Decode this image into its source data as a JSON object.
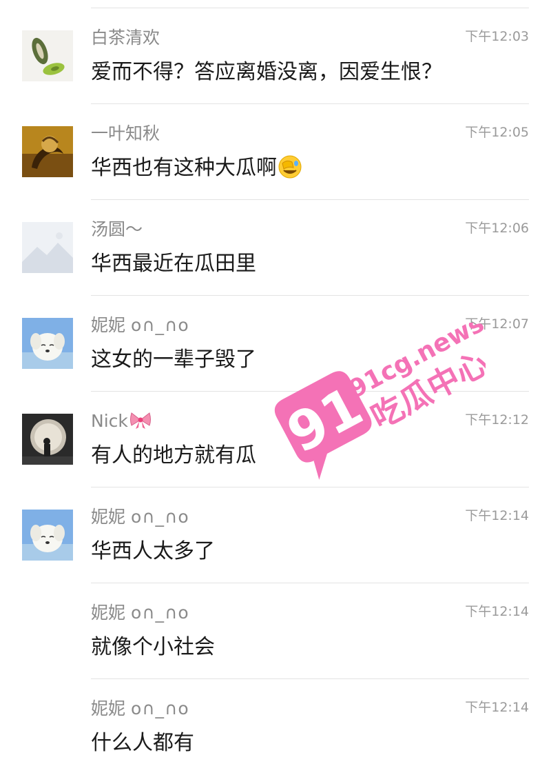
{
  "messages": [
    {
      "name": "白茶清欢",
      "name_suffix": "",
      "time": "下午12:03",
      "text": "爱而不得？答应离婚没离，因爱生恨？",
      "avatar": "leaf-avatar",
      "emoji": "",
      "name_icon": ""
    },
    {
      "name": "一叶知秋",
      "name_suffix": "",
      "time": "下午12:05",
      "text": "华西也有这种大瓜啊",
      "avatar": "autumn-avatar",
      "emoji": "facepalm-emoji",
      "name_icon": ""
    },
    {
      "name": "汤圆～",
      "name_suffix": "",
      "time": "下午12:06",
      "text": "华西最近在瓜田里",
      "avatar": "landscape-placeholder-avatar",
      "emoji": "",
      "name_icon": ""
    },
    {
      "name": "妮妮 ",
      "name_suffix": "o∩_∩o",
      "time": "下午12:07",
      "text": "这女的一辈子毁了",
      "avatar": "dog-avatar",
      "emoji": "",
      "name_icon": ""
    },
    {
      "name": "Nick",
      "name_suffix": "",
      "time": "下午12:12",
      "text": "有人的地方就有瓜",
      "avatar": "person-avatar",
      "emoji": "",
      "name_icon": "ribbon-bow-icon"
    },
    {
      "name": "妮妮 ",
      "name_suffix": "o∩_∩o",
      "time": "下午12:14",
      "text": "华西人太多了",
      "avatar": "dog-avatar",
      "emoji": "",
      "name_icon": ""
    },
    {
      "name": "妮妮 ",
      "name_suffix": "o∩_∩o",
      "time": "下午12:14",
      "text": "就像个小社会",
      "avatar": "",
      "emoji": "",
      "name_icon": ""
    },
    {
      "name": "妮妮 ",
      "name_suffix": "o∩_∩o",
      "time": "下午12:14",
      "text": "什么人都有",
      "avatar": "",
      "emoji": "",
      "name_icon": ""
    }
  ],
  "watermark": {
    "number": "91",
    "domain": "91cg.news",
    "caption": "吃瓜中心",
    "color": "#f472b6"
  }
}
